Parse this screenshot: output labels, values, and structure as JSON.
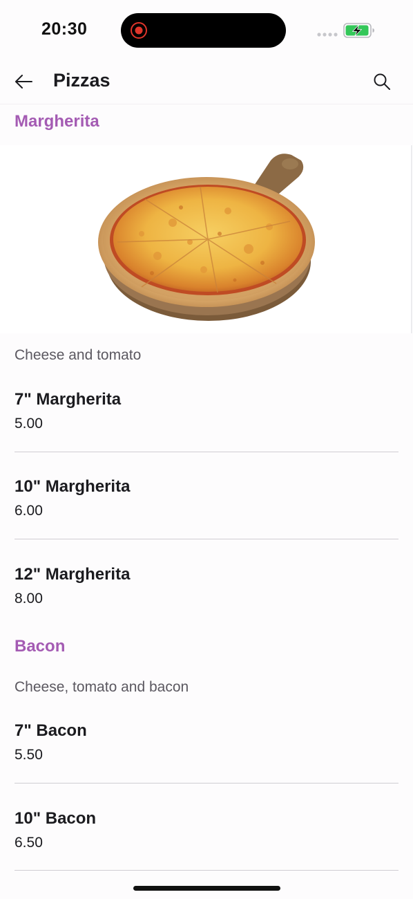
{
  "status_bar": {
    "time": "20:30"
  },
  "app_bar": {
    "title": "Pizzas",
    "back_icon": "arrow-left-icon",
    "search_icon": "search-icon"
  },
  "colors": {
    "accent": "#a45bb3",
    "text": "#1b1b1f",
    "muted": "#5b5860",
    "divider": "#cfcdd3",
    "battery_charging": "#34c759"
  },
  "sections": [
    {
      "title": "Margherita",
      "description": "Cheese and tomato",
      "image": "pizza-margherita-image",
      "items": [
        {
          "name": "7\" Margherita",
          "price": "5.00"
        },
        {
          "name": "10\" Margherita",
          "price": "6.00"
        },
        {
          "name": "12\" Margherita",
          "price": "8.00"
        }
      ]
    },
    {
      "title": "Bacon",
      "description": "Cheese, tomato and bacon",
      "items": [
        {
          "name": "7\" Bacon",
          "price": "5.50"
        },
        {
          "name": "10\" Bacon",
          "price": "6.50"
        }
      ]
    }
  ]
}
